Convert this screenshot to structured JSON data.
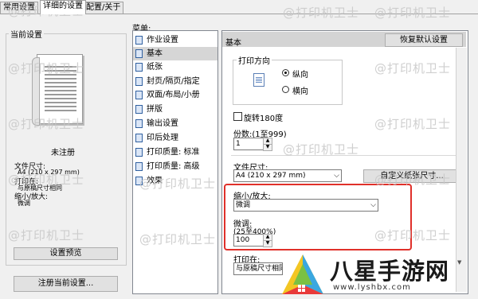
{
  "tabs": [
    "常用设置",
    "详细的设置",
    "配置/关于"
  ],
  "left": {
    "current_title": "当前设置",
    "unregistered": "未注册",
    "paper_size_label": "文件尺寸:",
    "paper_size_value": "A4 (210 x 297 mm)",
    "print_on_label": "打印在:",
    "print_on_value": "与原稿尺寸相同",
    "scale_label": "缩小/放大:",
    "scale_value": "微调",
    "preview_button": "设置预览",
    "register_button": "注册当前设置..."
  },
  "menu": {
    "label": "菜单:",
    "items": [
      "作业设置",
      "基本",
      "纸张",
      "封页/隔页/指定",
      "双面/布局/小册",
      "拼版",
      "输出设置",
      "印后处理",
      "打印质量: 标准",
      "打印质量: 高级",
      "效果"
    ],
    "selected_index": 1
  },
  "basic": {
    "header": "基本",
    "restore_button": "恢复默认设置",
    "orientation_label": "打印方向",
    "portrait": "纵向",
    "landscape": "横向",
    "rotate_label": "旋转180度",
    "copies_label": "份数:(1至999)",
    "copies_value": "1",
    "doc_size_label": "文件尺寸:",
    "doc_size_value": "A4 (210 x 297 mm)",
    "custom_size_button": "自定义纸张尺寸...",
    "scale_label": "缩小/放大:",
    "scale_value": "微调",
    "fine_label": "微调:",
    "fine_range": "(25至400%)",
    "fine_value": "100",
    "print_on_label": "打印在:",
    "print_on_value": "与原稿尺寸相同"
  },
  "watermark": "@打印机卫士",
  "brand": {
    "name": "八星手游网",
    "url": "www.lyshbx.com"
  },
  "colors": {
    "highlight_box": "#e0302a",
    "selected_tab": "#ffffff"
  }
}
